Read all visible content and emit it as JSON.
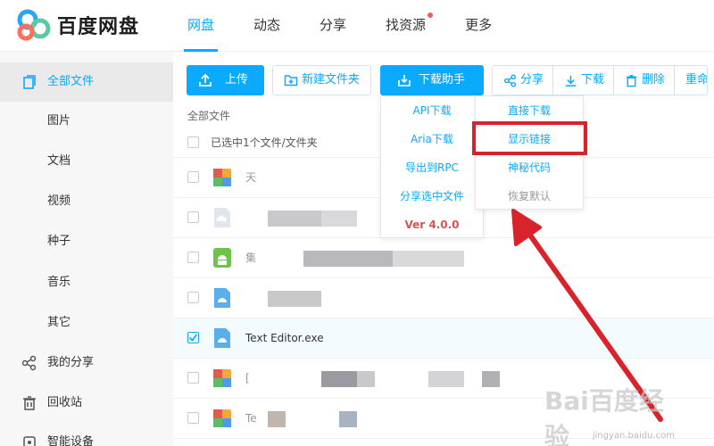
{
  "app": {
    "logo_text": "百度网盘"
  },
  "nav": {
    "items": [
      "网盘",
      "动态",
      "分享",
      "找资源",
      "更多"
    ],
    "active": "网盘"
  },
  "sidebar": {
    "items": [
      "全部文件",
      "图片",
      "文档",
      "视频",
      "种子",
      "音乐",
      "其它",
      "我的分享",
      "回收站",
      "智能设备"
    ]
  },
  "toolbar": {
    "upload": "上传",
    "new_folder": "新建文件夹",
    "download_helper": "下载助手",
    "share": "分享",
    "download": "下载",
    "delete": "删除",
    "rename": "重命"
  },
  "filelist": {
    "breadcrumb": "全部文件",
    "selection_text": "已选中1个文件/文件夹",
    "files": [
      {
        "name": "天",
        "icon": "archive-icon",
        "checked": false
      },
      {
        "name": "",
        "icon": "cloud-file-icon",
        "checked": false
      },
      {
        "name": "集",
        "icon": "android-icon",
        "checked": false
      },
      {
        "name": "",
        "icon": "exe-icon",
        "checked": false
      },
      {
        "name": "Text Editor.exe",
        "icon": "exe-icon",
        "checked": true
      },
      {
        "name": "[",
        "icon": "archive-icon",
        "checked": false
      },
      {
        "name": "Te",
        "icon": "archive-icon",
        "checked": false
      }
    ]
  },
  "dropdown_helper": {
    "items": [
      "API下载",
      "Aria下载",
      "导出到RPC",
      "分享选中文件"
    ],
    "version": "Ver 4.0.0"
  },
  "dropdown_api": {
    "items": [
      "直接下载",
      "显示链接",
      "神秘代码",
      "恢复默认"
    ]
  },
  "watermark": {
    "logo": "Bai百度经验",
    "url": "jingyan.baidu.com"
  },
  "colors": {
    "accent": "#09aaff",
    "highlight": "#d8232a",
    "version": "#d9534f"
  }
}
